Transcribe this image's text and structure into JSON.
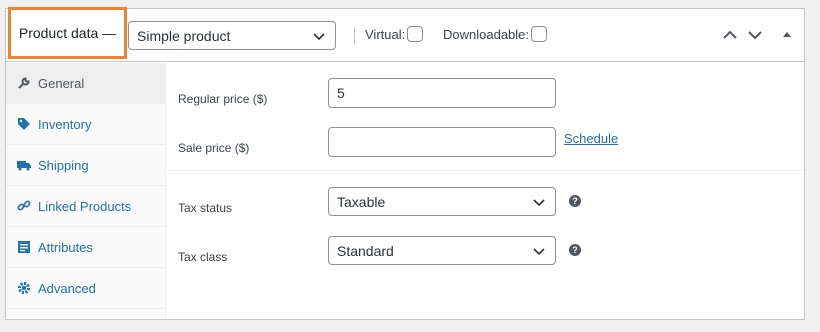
{
  "header": {
    "title": "Product data —",
    "product_type": "Simple product",
    "virtual_label": "Virtual:",
    "downloadable_label": "Downloadable:",
    "virtual_checked": false,
    "downloadable_checked": false
  },
  "sidebar": {
    "items": [
      {
        "label": "General",
        "icon": "wrench-icon",
        "active": true
      },
      {
        "label": "Inventory",
        "icon": "tag-icon",
        "active": false
      },
      {
        "label": "Shipping",
        "icon": "truck-icon",
        "active": false
      },
      {
        "label": "Linked Products",
        "icon": "link-icon",
        "active": false
      },
      {
        "label": "Attributes",
        "icon": "list-icon",
        "active": false
      },
      {
        "label": "Advanced",
        "icon": "gear-icon",
        "active": false
      }
    ]
  },
  "general": {
    "regular_price_label": "Regular price ($)",
    "regular_price_value": "5",
    "sale_price_label": "Sale price ($)",
    "sale_price_value": "",
    "schedule_link": "Schedule",
    "tax_status_label": "Tax status",
    "tax_status_value": "Taxable",
    "tax_class_label": "Tax class",
    "tax_class_value": "Standard"
  },
  "colors": {
    "accent_orange": "#f0822b",
    "link_blue": "#2271b1"
  }
}
